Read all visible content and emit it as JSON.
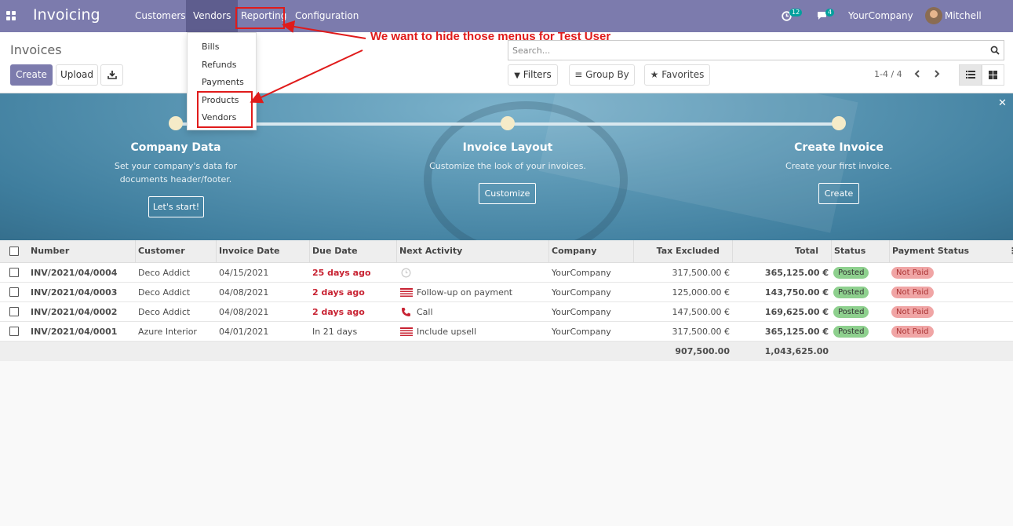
{
  "navbar": {
    "brand": "Invoicing",
    "menus": [
      "Customers",
      "Vendors",
      "Reporting",
      "Configuration"
    ],
    "activity_count": "12",
    "message_count": "4",
    "company": "YourCompany",
    "user": "Mitchell Admin"
  },
  "vendors_menu": {
    "items": [
      "Bills",
      "Refunds",
      "Payments",
      "Products",
      "Vendors"
    ]
  },
  "control_panel": {
    "title": "Invoices",
    "create_label": "Create",
    "upload_label": "Upload",
    "search_placeholder": "Search...",
    "filters_label": "Filters",
    "group_by_label": "Group By",
    "favorites_label": "Favorites",
    "pager": "1-4 / 4"
  },
  "onboarding": {
    "steps": [
      {
        "title": "Company Data",
        "desc_line1": "Set your company's data for",
        "desc_line2": "documents header/footer.",
        "button": "Let's start!"
      },
      {
        "title": "Invoice Layout",
        "desc_line1": "Customize the look of your invoices.",
        "desc_line2": "",
        "button": "Customize"
      },
      {
        "title": "Create Invoice",
        "desc_line1": "Create your first invoice.",
        "desc_line2": "",
        "button": "Create"
      }
    ]
  },
  "table": {
    "columns": [
      "Number",
      "Customer",
      "Invoice Date",
      "Due Date",
      "Next Activity",
      "Company",
      "Tax Excluded",
      "Total",
      "Status",
      "Payment Status"
    ],
    "rows": [
      {
        "number": "INV/2021/04/0004",
        "customer": "Deco Addict",
        "invoice_date": "04/15/2021",
        "due_date": "25 days ago",
        "activity": "",
        "activity_icon": "clock-icon",
        "company": "YourCompany",
        "tax_excluded": "317,500.00 €",
        "total": "365,125.00 €",
        "status": "Posted",
        "payment_status": "Not Paid"
      },
      {
        "number": "INV/2021/04/0003",
        "customer": "Deco Addict",
        "invoice_date": "04/08/2021",
        "due_date": "2 days ago",
        "activity": "Follow-up on payment",
        "activity_icon": "flag-icon",
        "company": "YourCompany",
        "tax_excluded": "125,000.00 €",
        "total": "143,750.00 €",
        "status": "Posted",
        "payment_status": "Not Paid"
      },
      {
        "number": "INV/2021/04/0002",
        "customer": "Deco Addict",
        "invoice_date": "04/08/2021",
        "due_date": "2 days ago",
        "activity": "Call",
        "activity_icon": "phone-icon",
        "company": "YourCompany",
        "tax_excluded": "147,500.00 €",
        "total": "169,625.00 €",
        "status": "Posted",
        "payment_status": "Not Paid"
      },
      {
        "number": "INV/2021/04/0001",
        "customer": "Azure Interior",
        "invoice_date": "04/01/2021",
        "due_date": "In 21 days",
        "activity": "Include upsell",
        "activity_icon": "flag-icon",
        "company": "YourCompany",
        "tax_excluded": "317,500.00 €",
        "total": "365,125.00 €",
        "status": "Posted",
        "payment_status": "Not Paid"
      }
    ],
    "totals": {
      "tax_excluded": "907,500.00",
      "total": "1,043,625.00"
    }
  },
  "annotation": {
    "text": "We want to hide those menus for Test User",
    "color": "#e01b1b"
  },
  "colors": {
    "brand": "#7c7bad",
    "overdue": "#c82333",
    "posted": "#8ed08e",
    "not_paid": "#f0a5a5"
  }
}
